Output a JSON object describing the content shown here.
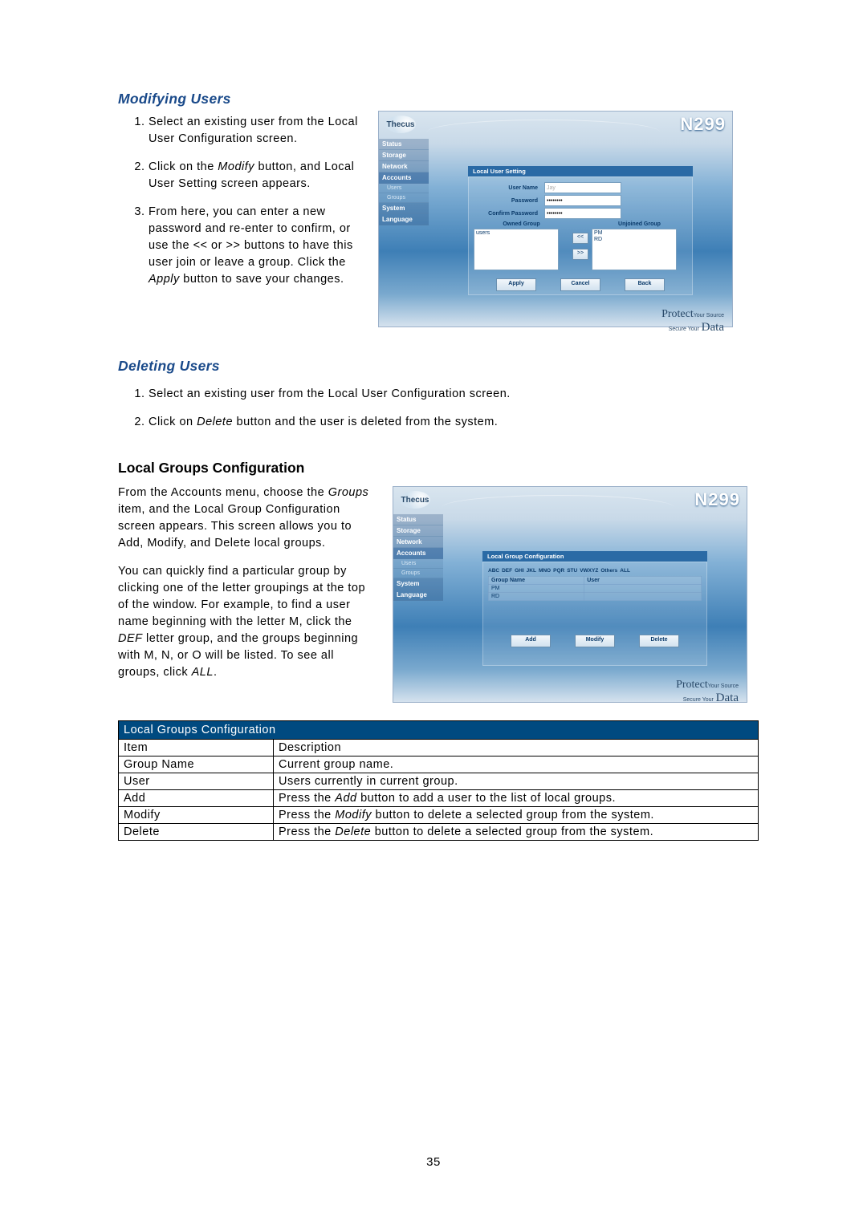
{
  "page_number": "35",
  "section1": {
    "title": "Modifying Users",
    "steps_html": [
      "Select an existing user from the Local User Configuration screen.",
      "Click on the <em class='manual-italic'>Modify</em> button, and Local User Setting screen appears.",
      "From here, you can enter a new password and re-enter to confirm, or use the &lt;&lt; or &gt;&gt; buttons to have this user join or leave a group. Click the <em class='manual-italic'>Apply</em> button to save your changes."
    ]
  },
  "section2": {
    "title": "Deleting Users",
    "steps_html": [
      "Select an existing user from the Local User Configuration screen.",
      "Click on <em class='manual-italic'>Delete</em> button and the user is deleted from the system."
    ]
  },
  "section3": {
    "title": "Local Groups Configuration",
    "para1_html": "From the Accounts menu, choose the <em class='manual-italic'>Groups</em> item, and the Local Group Configuration screen appears. This screen allows you to Add, Modify, and Delete local groups.",
    "para2_html": "You can quickly find a particular group by clicking one of the letter groupings at the top of the window. For example, to find a user name beginning with the letter M, click the <em class='manual-italic'>DEF</em> letter group, and the groups beginning with M, N, or O will be listed. To see all groups, click <em class='manual-italic'>ALL</em>."
  },
  "shot_common": {
    "logo": "Thecus",
    "model": "N299",
    "nav": [
      "Status",
      "Storage",
      "Network",
      "Accounts",
      "Users",
      "Groups",
      "System",
      "Language"
    ],
    "footer_big": "Protect",
    "footer_small": "Your Source",
    "footer_small2": "Secure Your",
    "footer_data": "Data"
  },
  "shot1": {
    "panel_title": "Local User Setting",
    "rows": {
      "user_name_label": "User Name",
      "user_name_value": "Jay",
      "password_label": "Password",
      "password_value": "********",
      "confirm_label": "Confirm Password",
      "confirm_value": "********"
    },
    "owned_label": "Owned Group",
    "unjoined_label": "Unjoined Group",
    "owned_items": [
      "users"
    ],
    "unjoined_items": [
      "PM",
      "RD"
    ],
    "arrow_left": "<<",
    "arrow_right": ">>",
    "buttons": [
      "Apply",
      "Cancel",
      "Back"
    ]
  },
  "shot2": {
    "panel_title": "Local Group Configuration",
    "alpha": [
      "ABC",
      "DEF",
      "GHI",
      "JKL",
      "MNO",
      "PQR",
      "STU",
      "VWXYZ",
      "Others",
      "ALL"
    ],
    "headers": [
      "Group Name",
      "User"
    ],
    "rows": [
      [
        "PM",
        ""
      ],
      [
        "RD",
        ""
      ]
    ],
    "buttons": [
      "Add",
      "Modify",
      "Delete"
    ]
  },
  "doc_table": {
    "title": "Local Groups Configuration",
    "headers": [
      "Item",
      "Description"
    ],
    "rows": [
      [
        "Group Name",
        "Current group name."
      ],
      [
        "User",
        "Users currently in current group."
      ],
      [
        "Add",
        "Press the <em class='manual-italic'>Add</em> button to add a user to the list of local groups."
      ],
      [
        "Modify",
        "Press the <em class='manual-italic'>Modify</em> button to delete a selected group from the system."
      ],
      [
        "Delete",
        "Press the <em class='manual-italic'>Delete</em> button to delete a selected group from the system."
      ]
    ]
  }
}
